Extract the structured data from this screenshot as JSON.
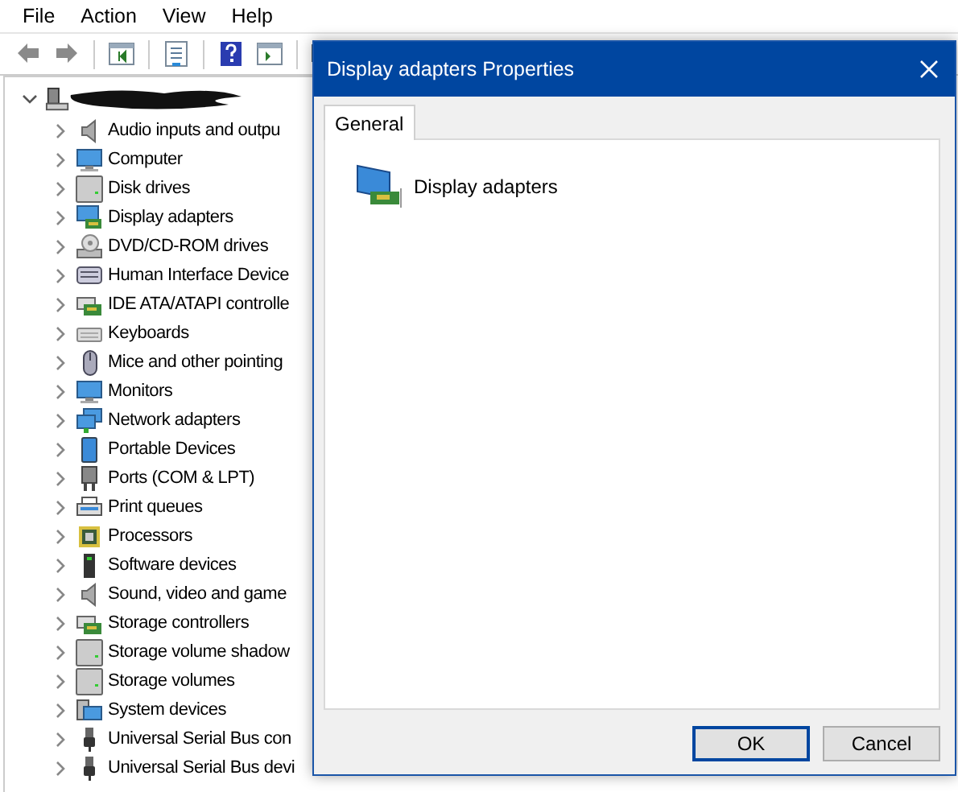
{
  "menu_bar": [
    "File",
    "Action",
    "View",
    "Help"
  ],
  "tree": {
    "root": {
      "expanded": true,
      "redacted": true
    },
    "items": [
      {
        "label": "Audio inputs and outpu",
        "kind": "speaker",
        "expanded": false
      },
      {
        "label": "Computer",
        "kind": "monitor",
        "expanded": false
      },
      {
        "label": "Disk drives",
        "kind": "drive",
        "expanded": false
      },
      {
        "label": "Display adapters",
        "kind": "adapter",
        "expanded": false
      },
      {
        "label": "DVD/CD-ROM drives",
        "kind": "disc",
        "expanded": false
      },
      {
        "label": "Human Interface Device",
        "kind": "hid",
        "expanded": false
      },
      {
        "label": "IDE ATA/ATAPI controlle",
        "kind": "card",
        "expanded": false
      },
      {
        "label": "Keyboards",
        "kind": "keyboard",
        "expanded": false
      },
      {
        "label": "Mice and other pointing",
        "kind": "mouse",
        "expanded": false
      },
      {
        "label": "Monitors",
        "kind": "monitor",
        "expanded": false
      },
      {
        "label": "Network adapters",
        "kind": "network",
        "expanded": false
      },
      {
        "label": "Portable Devices",
        "kind": "phone",
        "expanded": false
      },
      {
        "label": "Ports (COM & LPT)",
        "kind": "port",
        "expanded": false
      },
      {
        "label": "Print queues",
        "kind": "printer",
        "expanded": false
      },
      {
        "label": "Processors",
        "kind": "chip",
        "expanded": false
      },
      {
        "label": "Software devices",
        "kind": "tower",
        "expanded": false
      },
      {
        "label": "Sound, video and game",
        "kind": "speaker",
        "expanded": false
      },
      {
        "label": "Storage controllers",
        "kind": "card",
        "expanded": false
      },
      {
        "label": "Storage volume shadow",
        "kind": "drive",
        "expanded": false
      },
      {
        "label": "Storage volumes",
        "kind": "drive",
        "expanded": false
      },
      {
        "label": "System devices",
        "kind": "system",
        "expanded": false
      },
      {
        "label": "Universal Serial Bus con",
        "kind": "usb",
        "expanded": false
      },
      {
        "label": "Universal Serial Bus devi",
        "kind": "usb",
        "expanded": false
      }
    ]
  },
  "dialog": {
    "title": "Display adapters Properties",
    "tabs": [
      {
        "label": "General",
        "selected": true
      }
    ],
    "heading": "Display adapters",
    "buttons": [
      {
        "label": "OK",
        "default": true
      },
      {
        "label": "Cancel",
        "default": false
      }
    ]
  }
}
